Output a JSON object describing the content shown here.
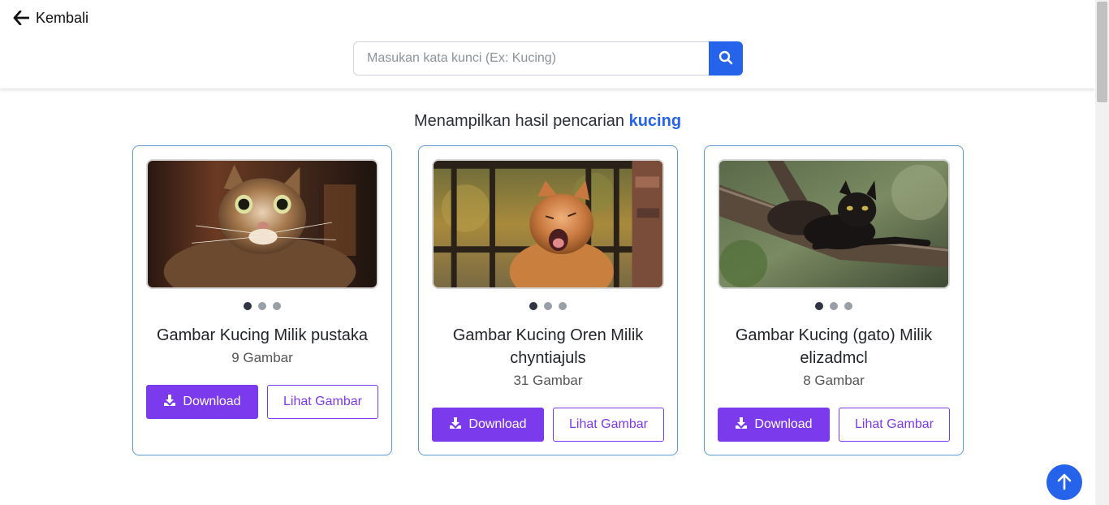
{
  "header": {
    "back_label": "Kembali",
    "back_icon": "arrow-left-icon",
    "search": {
      "placeholder": "Masukan kata kunci (Ex: Kucing)",
      "value": "",
      "button_icon": "search-icon"
    }
  },
  "results": {
    "prefix": "Menampilkan hasil pencarian",
    "keyword": "kucing"
  },
  "cards": [
    {
      "title": "Gambar Kucing Milik pustaka",
      "count": "9 Gambar",
      "image": "tabby cat looking up",
      "slides": 3,
      "active_slide": 1,
      "download_label": "Download",
      "view_label": "Lihat Gambar"
    },
    {
      "title": "Gambar Kucing Oren Milik chyntiajuls",
      "count": "31 Gambar",
      "image": "orange cat yawning by a fence",
      "slides": 3,
      "active_slide": 1,
      "download_label": "Download",
      "view_label": "Lihat Gambar"
    },
    {
      "title": "Gambar Kucing (gato) Milik elizadmcl",
      "count": "8 Gambar",
      "image": "black cat on a tree branch",
      "slides": 3,
      "active_slide": 1,
      "download_label": "Download",
      "view_label": "Lihat Gambar"
    }
  ],
  "icons": {
    "download": "download-icon",
    "scroll_top": "arrow-up-icon"
  },
  "colors": {
    "primary_blue": "#2563eb",
    "purple": "#7c3aed",
    "card_border": "#5b9bd5"
  }
}
